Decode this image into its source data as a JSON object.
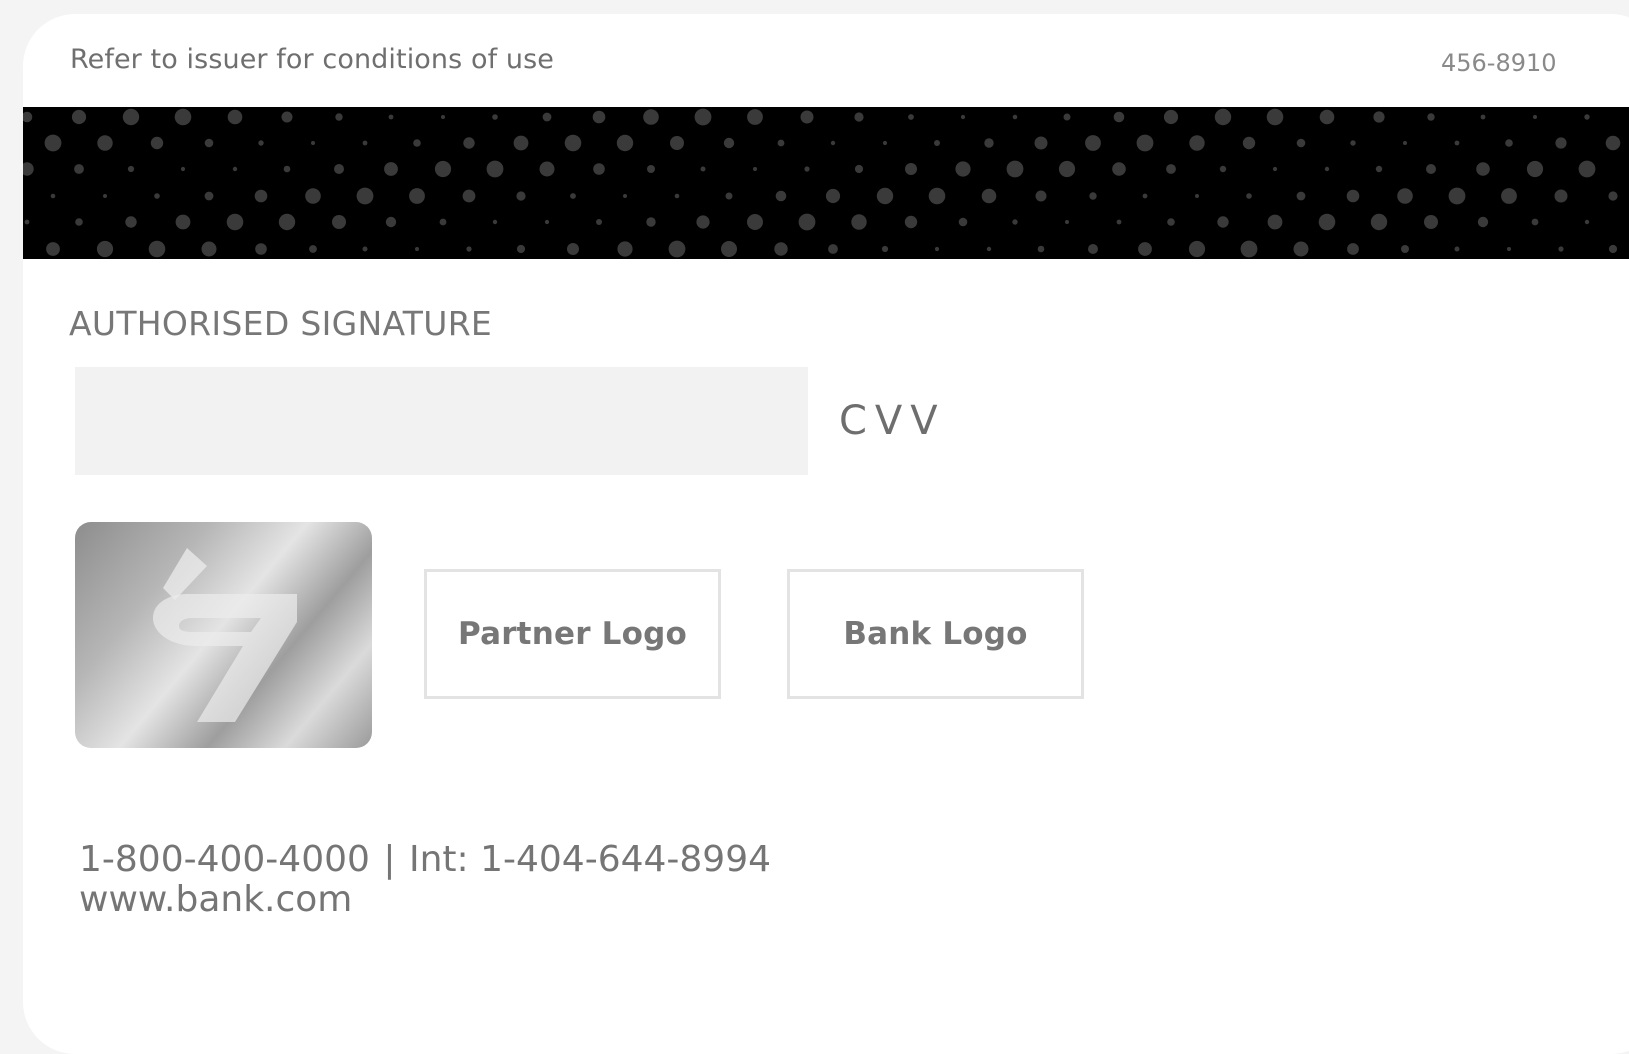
{
  "card": {
    "disclaimer": "Refer to issuer for conditions of use",
    "card_id": "456-8910",
    "signature_heading": "AUTHORISED SIGNATURE",
    "cvv_label": "CVV",
    "logos": {
      "partner": "Partner Logo",
      "bank": "Bank Logo"
    },
    "contact": {
      "phone": "1-800-400-4000",
      "divider": "|",
      "international": "Int: 1-404-644-8994",
      "website": "www.bank.com"
    }
  },
  "colors": {
    "card_background": "#ffffff",
    "page_background": "#f4f4f4",
    "stripe": "#000000",
    "stripe_dots": "#3a3a3a",
    "signature_panel": "#f2f2f2",
    "text": "#757575"
  },
  "icons": {
    "hologram": "hologram-emblem-icon"
  }
}
